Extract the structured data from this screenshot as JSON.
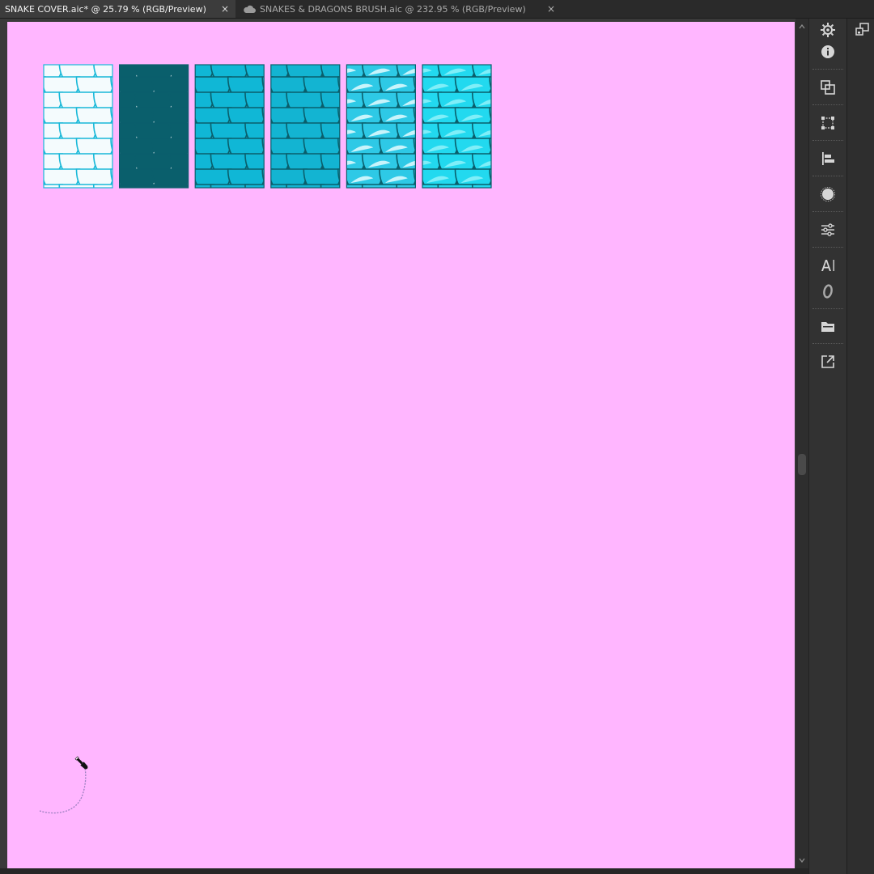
{
  "tabs": [
    {
      "label": "SNAKE COVER.aic* @ 25.79 % (RGB/Preview)",
      "close": "×",
      "active": true
    },
    {
      "label": "SNAKES & DRAGONS BRUSH.aic @ 232.95 % (RGB/Preview)",
      "close": "×",
      "active": false,
      "icon": "cloud-icon"
    }
  ],
  "artboard": {
    "color": "#ffb6ff"
  },
  "swatches": [
    {
      "base": "#ffffff",
      "scale": "#f4fbfd",
      "stroke": "#18b8d8",
      "highlight": ""
    },
    {
      "base": "#ffffff",
      "scale": "#0a5f6c",
      "stroke": "#0a5f6c",
      "highlight": ""
    },
    {
      "base": "#12b5d3",
      "scale": "#10b7d6",
      "stroke": "#0a5f6c",
      "highlight": ""
    },
    {
      "base": "#0a5f6c",
      "scale": "#13b4d2",
      "stroke": "#0a5f6c",
      "highlight": ""
    },
    {
      "base": "#0b6f7e",
      "scale": "#2ec9e6",
      "stroke": "#0a5f6c",
      "highlight": "#c8f4fb"
    },
    {
      "base": "#0a5f6c",
      "scale": "#22d9ef",
      "stroke": "#0a5f6c",
      "highlight": "#7feef8"
    }
  ],
  "panel_icons": [
    "gear-icon",
    "info-icon",
    "pathfinder-icon",
    "transform-icon",
    "align-icon",
    "appearance-icon",
    "properties-icon",
    "character-icon",
    "glyphs-icon",
    "libraries-icon",
    "export-icon"
  ],
  "far_panel_icons": [
    "arrange-icon"
  ]
}
